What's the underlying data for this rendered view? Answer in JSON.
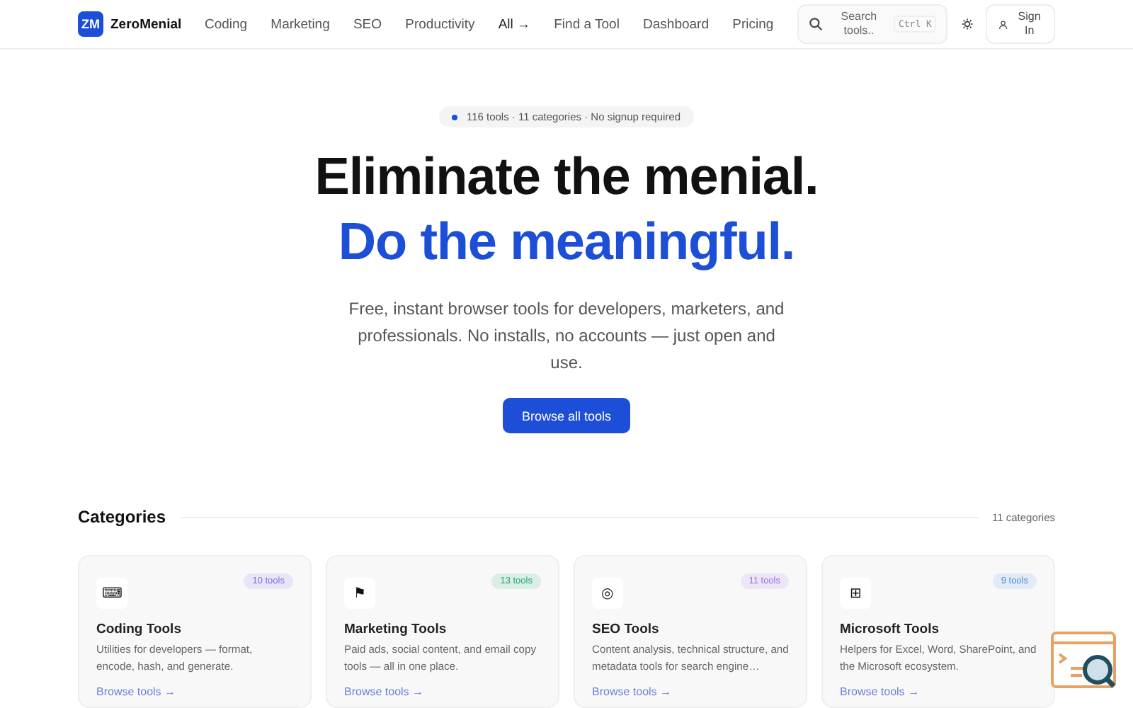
{
  "brand": {
    "logo": "ZM",
    "name": "ZeroMenial"
  },
  "nav": [
    {
      "label": "Coding",
      "kind": "plain"
    },
    {
      "label": "Marketing",
      "kind": "plain"
    },
    {
      "label": "SEO",
      "kind": "plain"
    },
    {
      "label": "Productivity",
      "kind": "plain"
    },
    {
      "label": "All →",
      "kind": "strong"
    },
    {
      "label": "Find a Tool",
      "kind": "plain"
    },
    {
      "label": "Dashboard",
      "kind": "plain"
    },
    {
      "label": "Pricing",
      "kind": "plain"
    }
  ],
  "search": {
    "placeholder": "Search tools..",
    "shortcut": "Ctrl K"
  },
  "sign_in": "Sign In",
  "hero": {
    "pill": "116 tools · 11 categories · No signup required",
    "title": "Eliminate the menial.",
    "subtitle": "Do the meaningful.",
    "description": "Free, instant browser tools for developers, marketers, and professionals. No installs, no accounts — just open and use.",
    "cta": "Browse all tools"
  },
  "categories": {
    "heading": "Categories",
    "count": "11 categories",
    "cards": [
      {
        "icon": "⌨",
        "count": "10 tools",
        "color": "#7c6ee6",
        "title": "Coding Tools",
        "description": "Utilities for developers — format, encode, hash, and generate.",
        "link": "Browse tools →"
      },
      {
        "icon": "⚑",
        "count": "13 tools",
        "color": "#1fa971",
        "title": "Marketing Tools",
        "description": "Paid ads, social content, and email copy tools — all in one place.",
        "link": "Browse tools →"
      },
      {
        "icon": "◎",
        "count": "11 tools",
        "color": "#9b6fe0",
        "title": "SEO Tools",
        "description": "Content analysis, technical structure, and metadata tools for search engine…",
        "link": "Browse tools →"
      },
      {
        "icon": "⊞",
        "count": "9 tools",
        "color": "#4a8ee0",
        "title": "Microsoft Tools",
        "description": "Helpers for Excel, Word, SharePoint, and the Microsoft ecosystem.",
        "link": "Browse tools →"
      }
    ]
  }
}
